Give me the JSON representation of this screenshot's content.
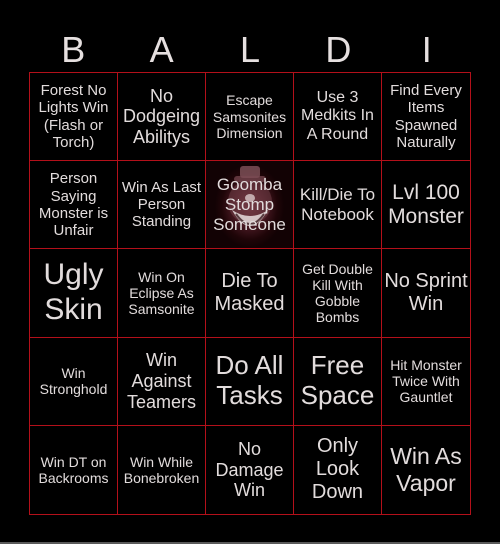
{
  "header": {
    "letters": [
      "B",
      "A",
      "L",
      "D",
      "I"
    ]
  },
  "colors": {
    "background": "#000000",
    "grid_border": "#b3101a",
    "text": "#e2dcdc"
  },
  "board": {
    "cells": [
      {
        "text": "Forest No Lights Win (Flash or Torch)"
      },
      {
        "text": "No Dodgeing Abilitys"
      },
      {
        "text": "Escape Samsonites Dimension"
      },
      {
        "text": "Use 3 Medkits In A Round"
      },
      {
        "text": "Find Every Items Spawned Naturally"
      },
      {
        "text": "Person Saying Monster is Unfair"
      },
      {
        "text": "Win As Last Person Standing"
      },
      {
        "text": "Goomba Stomp Someone",
        "background_icon": "monster-face-icon"
      },
      {
        "text": "Kill/Die To Notebook"
      },
      {
        "text": "Lvl 100 Monster"
      },
      {
        "text": "Ugly Skin"
      },
      {
        "text": "Win On Eclipse As Samsonite"
      },
      {
        "text": "Die To Masked"
      },
      {
        "text": "Get Double Kill With Gobble Bombs"
      },
      {
        "text": "No Sprint Win"
      },
      {
        "text": "Win Stronghold"
      },
      {
        "text": "Win Against Teamers"
      },
      {
        "text": "Do All Tasks"
      },
      {
        "text": "Free Space"
      },
      {
        "text": "Hit Monster Twice With Gauntlet"
      },
      {
        "text": "Win DT on Backrooms"
      },
      {
        "text": "Win While Bonebroken"
      },
      {
        "text": "No Damage Win"
      },
      {
        "text": "Only Look Down"
      },
      {
        "text": "Win As Vapor"
      }
    ]
  }
}
